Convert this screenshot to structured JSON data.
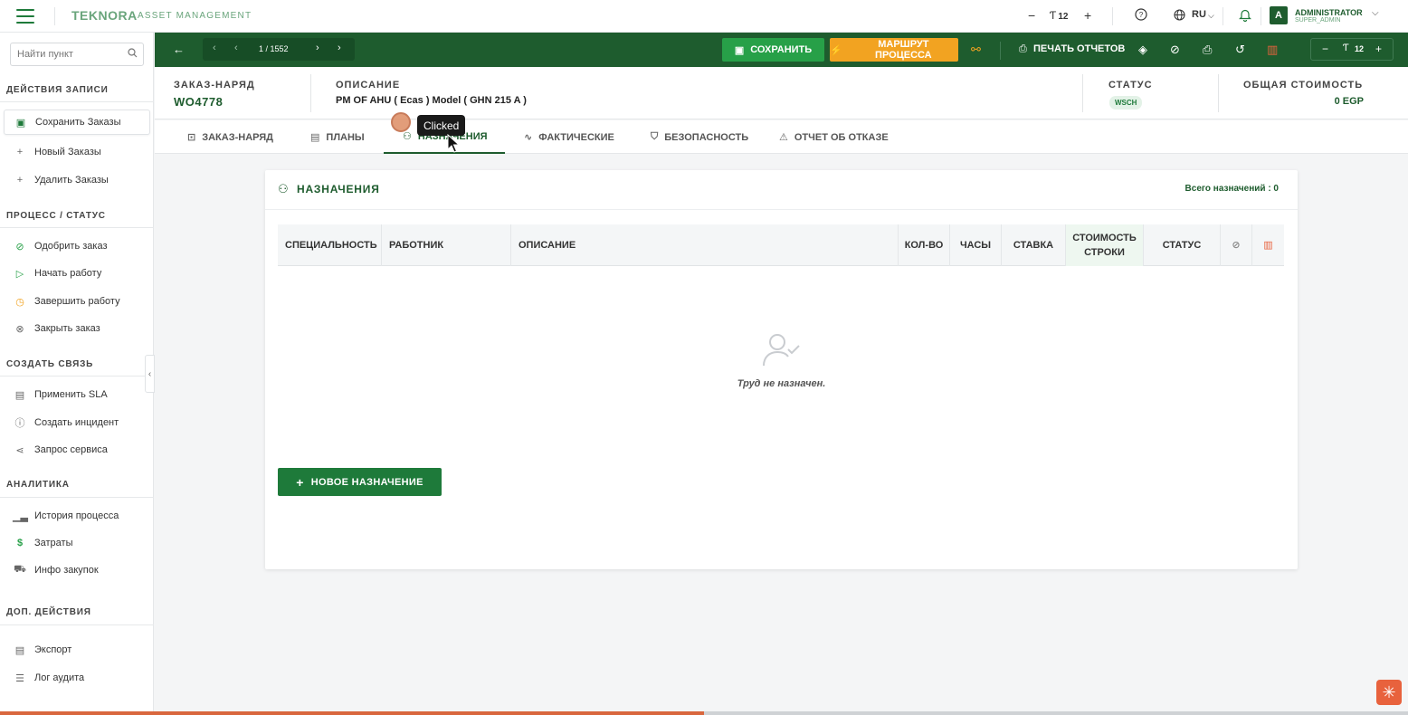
{
  "app": {
    "logo": "TEKNORA",
    "logo_sub": "ASSET MANAGEMENT",
    "font_size": "12",
    "lang": "RU",
    "user_name": "ADMINISTRATOR",
    "user_role": "SUPER_ADMIN",
    "avatar_letter": "A"
  },
  "sidebar": {
    "search_placeholder": "Найти пункт",
    "sections": [
      {
        "title": "ДЕЙСТВИЯ ЗАПИСИ",
        "items": [
          {
            "label": "Сохранить Заказы",
            "icon": "save-icon"
          },
          {
            "label": "Новый Заказы",
            "icon": "plus-icon"
          },
          {
            "label": "Удалить Заказы",
            "icon": "plus-icon"
          }
        ]
      },
      {
        "title": "ПРОЦЕСС / СТАТУС",
        "items": [
          {
            "label": "Одобрить заказ",
            "icon": "check-circle-icon"
          },
          {
            "label": "Начать работу",
            "icon": "play-icon"
          },
          {
            "label": "Завершить работу",
            "icon": "clock-icon"
          },
          {
            "label": "Закрыть заказ",
            "icon": "x-circle-icon"
          }
        ]
      },
      {
        "title": "СОЗДАТЬ СВЯЗЬ",
        "items": [
          {
            "label": "Применить SLA",
            "icon": "document-icon"
          },
          {
            "label": "Создать инцидент",
            "icon": "alert-circle-icon"
          },
          {
            "label": "Запрос сервиса",
            "icon": "share-icon"
          }
        ]
      },
      {
        "title": "АНАЛИТИКА",
        "items": [
          {
            "label": "История процесса",
            "icon": "bar-chart-icon"
          },
          {
            "label": "Затраты",
            "icon": "dollar-icon"
          },
          {
            "label": "Инфо закупок",
            "icon": "cart-icon"
          }
        ]
      },
      {
        "title": "ДОП. ДЕЙСТВИЯ",
        "items": [
          {
            "label": "Экспорт",
            "icon": "document-icon"
          },
          {
            "label": "Лог аудита",
            "icon": "list-icon"
          }
        ]
      }
    ]
  },
  "toolbar": {
    "pager_text": "1 / 1552",
    "save_label": "СОХРАНИТЬ",
    "route_label": "МАРШРУТ ПРОЦЕССА",
    "print_label": "ПЕЧАТЬ ОТЧЕТОВ",
    "zoom_value": "12"
  },
  "record": {
    "wo_label": "ЗАКАЗ-НАРЯД",
    "wo_value": "WO4778",
    "desc_label": "ОПИСАНИЕ",
    "desc_value": "PM OF AHU   ( Ecas )  Model ( GHN 215 A )",
    "status_label": "СТАТУС",
    "status_value": "WSCH",
    "cost_label": "ОБЩАЯ СТОИМОСТЬ",
    "cost_value": "0 EGP"
  },
  "tabs": [
    {
      "label": "ЗАКАЗ-НАРЯД",
      "icon": "briefcase-icon"
    },
    {
      "label": "ПЛАНЫ",
      "icon": "document-icon"
    },
    {
      "label": "НАЗНАЧЕНИЯ",
      "icon": "user-check-icon"
    },
    {
      "label": "ФАКТИЧЕСКИЕ",
      "icon": "activity-icon"
    },
    {
      "label": "БЕЗОПАСНОСТЬ",
      "icon": "shield-icon"
    },
    {
      "label": "ОТЧЕТ ОБ ОТКАЗЕ",
      "icon": "warning-icon"
    }
  ],
  "assignments": {
    "title": "НАЗНАЧЕНИЯ",
    "count_text": "Всего назначений : 0",
    "columns": [
      "СПЕЦИАЛЬНОСТЬ",
      "РАБОТНИК",
      "ОПИСАНИЕ",
      "КОЛ-ВО",
      "ЧАСЫ",
      "СТАВКА",
      "СТОИМОСТЬ СТРОКИ",
      "СТАТУС"
    ],
    "empty_text": "Труд не назначен.",
    "new_button": "НОВОЕ НАЗНАЧЕНИЕ"
  },
  "overlay": {
    "tooltip": "Clicked"
  }
}
